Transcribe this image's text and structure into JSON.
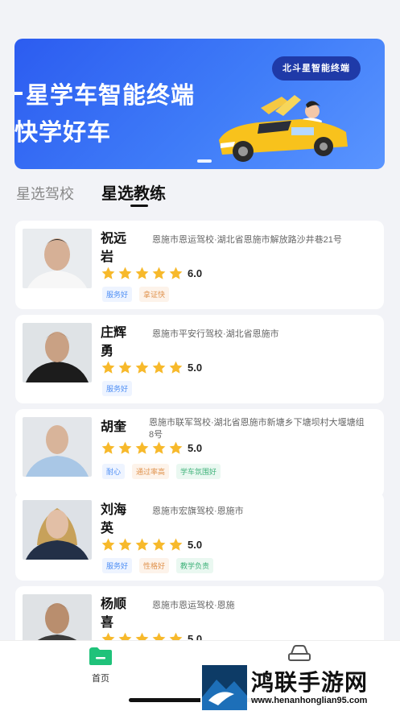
{
  "banner": {
    "badge": "北斗星智能终端",
    "line1": "星学车智能终端",
    "line2": "快学好车",
    "slide_count": 1
  },
  "tabs": [
    {
      "label": "星选驾校",
      "active": false
    },
    {
      "label": "星选教练",
      "active": true
    }
  ],
  "coaches": [
    {
      "name": "祝远岩",
      "school": "恩施市恩运驾校·湖北省恩施市解放路沙井巷21号",
      "stars": 5,
      "score": "6.0",
      "tags": [
        {
          "text": "服务好",
          "color": "blue"
        },
        {
          "text": "拿证快",
          "color": "orange"
        }
      ]
    },
    {
      "name": "庄辉勇",
      "school": "恩施市平安行驾校·湖北省恩施市",
      "stars": 5,
      "score": "5.0",
      "tags": [
        {
          "text": "服务好",
          "color": "blue"
        }
      ]
    },
    {
      "name": "胡奎",
      "school": "恩施市联军驾校·湖北省恩施市新塘乡下塘坝村大堰塘组8号",
      "stars": 5,
      "score": "5.0",
      "tags": [
        {
          "text": "耐心",
          "color": "blue"
        },
        {
          "text": "通过率高",
          "color": "orange"
        },
        {
          "text": "学车氛围好",
          "color": "green"
        }
      ]
    },
    {
      "name": "刘海英",
      "school": "恩施市宏旗驾校·恩施市",
      "stars": 5,
      "score": "5.0",
      "tags": [
        {
          "text": "服务好",
          "color": "blue"
        },
        {
          "text": "性格好",
          "color": "orange"
        },
        {
          "text": "教学负责",
          "color": "green"
        }
      ]
    },
    {
      "name": "杨顺喜",
      "school": "恩施市恩运驾校·恩施",
      "stars": 5,
      "score": "5.0",
      "tags": []
    }
  ],
  "bottom_nav": {
    "home_label": "首页"
  },
  "watermark": {
    "title": "鸿联手游网",
    "url": "www.henanhonglian95.com"
  },
  "colors": {
    "accent": "#1fc27a",
    "banner_blue": "#3f7cf8",
    "star": "#f7b92b"
  }
}
